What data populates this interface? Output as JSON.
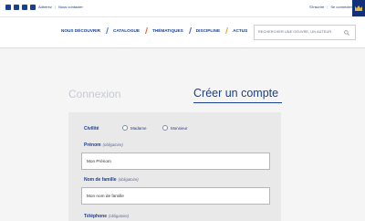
{
  "topbar": {
    "social": [
      "facebook-icon",
      "twitter-icon",
      "youtube-icon",
      "linkedin-icon"
    ],
    "links": [
      "Adhérez",
      "Nous contacter"
    ],
    "user_links": [
      "S'inscrire",
      "Se connecter"
    ]
  },
  "nav": {
    "items": [
      {
        "label": "NOUS DÉCOUVRIR",
        "tick_color": "#1b3f8f"
      },
      {
        "label": "CATALOGUE",
        "tick_color": "#2d6cdf"
      },
      {
        "label": "THÉMATIQUES",
        "tick_color": "#e0572a"
      },
      {
        "label": "DISCIPLINE",
        "tick_color": "#3a55c9"
      },
      {
        "label": "ACTUS",
        "tick_color": "#e79a1d"
      }
    ],
    "search_placeholder": "RECHERCHER UNE OEUVRE, UN AUTEUR"
  },
  "tabs": {
    "login": "Connexion",
    "register": "Créer un compte"
  },
  "form": {
    "civility_label": "Civilité",
    "civility_options": [
      "Madame",
      "Monsieur"
    ],
    "firstname_label": "Prénom",
    "firstname_hint": "(obligatoire)",
    "firstname_value": "Mon Prénom",
    "lastname_label": "Nom de famille",
    "lastname_hint": "(obligatoire)",
    "lastname_value": "Mon nom de famille",
    "phone_label": "Téléphone",
    "phone_hint": "(obligatoire)"
  },
  "colors": {
    "brand": "#1b3f8f",
    "panel": "#e9e9e9",
    "background": "#f5f5f5"
  }
}
